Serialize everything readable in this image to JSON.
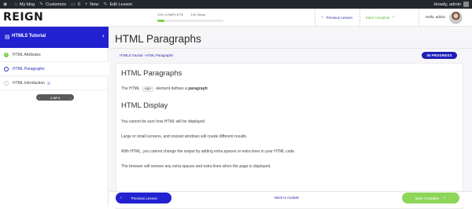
{
  "adminbar": {
    "items": [
      {
        "icon": "wordpress-icon",
        "glyph": "◉",
        "label": ""
      },
      {
        "icon": "home-icon",
        "glyph": "⌂",
        "label": "My blog"
      },
      {
        "icon": "customize-icon",
        "glyph": "✎",
        "label": "Customize"
      },
      {
        "icon": "comment-icon",
        "glyph": "▭",
        "label": "0"
      },
      {
        "icon": "plus-icon",
        "glyph": "+",
        "label": "New"
      },
      {
        "icon": "pencil-icon",
        "glyph": "✎",
        "label": "Edit Lesson"
      }
    ],
    "howdy": "Howdy, admin"
  },
  "header": {
    "logo": "REIGN",
    "progress_percent_text": "11% COMPLETE",
    "progress_steps": "1/8 Steps",
    "progress_fraction": 0.11,
    "previous_lesson": "Previous Lesson",
    "mark_complete": "Mark Complete",
    "hello": "Hello, admin"
  },
  "sidebar": {
    "course_title": "HTML5 Tutorial",
    "lessons": [
      {
        "label": "HTML Attributes",
        "status": "done"
      },
      {
        "label": "HTML Paragraphs",
        "status": "current"
      },
      {
        "label": "HTML Introduction",
        "status": "empty"
      }
    ],
    "pager": "1 OF 2"
  },
  "main": {
    "title": "HTML Paragraphs",
    "breadcrumb": "HTML5 Tutorial › HTML Paragraphs",
    "status": "IN PROGRESS",
    "content": {
      "h_paragraphs": "HTML Paragraphs",
      "p_intro_before": "The HTML",
      "p_intro_code": "<p>",
      "p_intro_middle": "element defines a",
      "p_intro_bold": "paragraph",
      "p_intro_end": ":",
      "h_display": "HTML Display",
      "paragraphs": [
        "You cannot be sure how HTML will be displayed.",
        "Large or small screens, and resized windows will create different results.",
        "With HTML, you cannot change the output by adding extra spaces or extra lines in your HTML code.",
        "The browser will remove any extra spaces and extra lines when the page is displayed."
      ]
    },
    "footer": {
      "previous_lesson": "Previous Lesson",
      "back_to_module": "Back to module",
      "mark_complete": "Mark Complete"
    }
  },
  "colors": {
    "primary": "#2222d0",
    "success": "#7fd147",
    "adminbar": "#23282d"
  }
}
